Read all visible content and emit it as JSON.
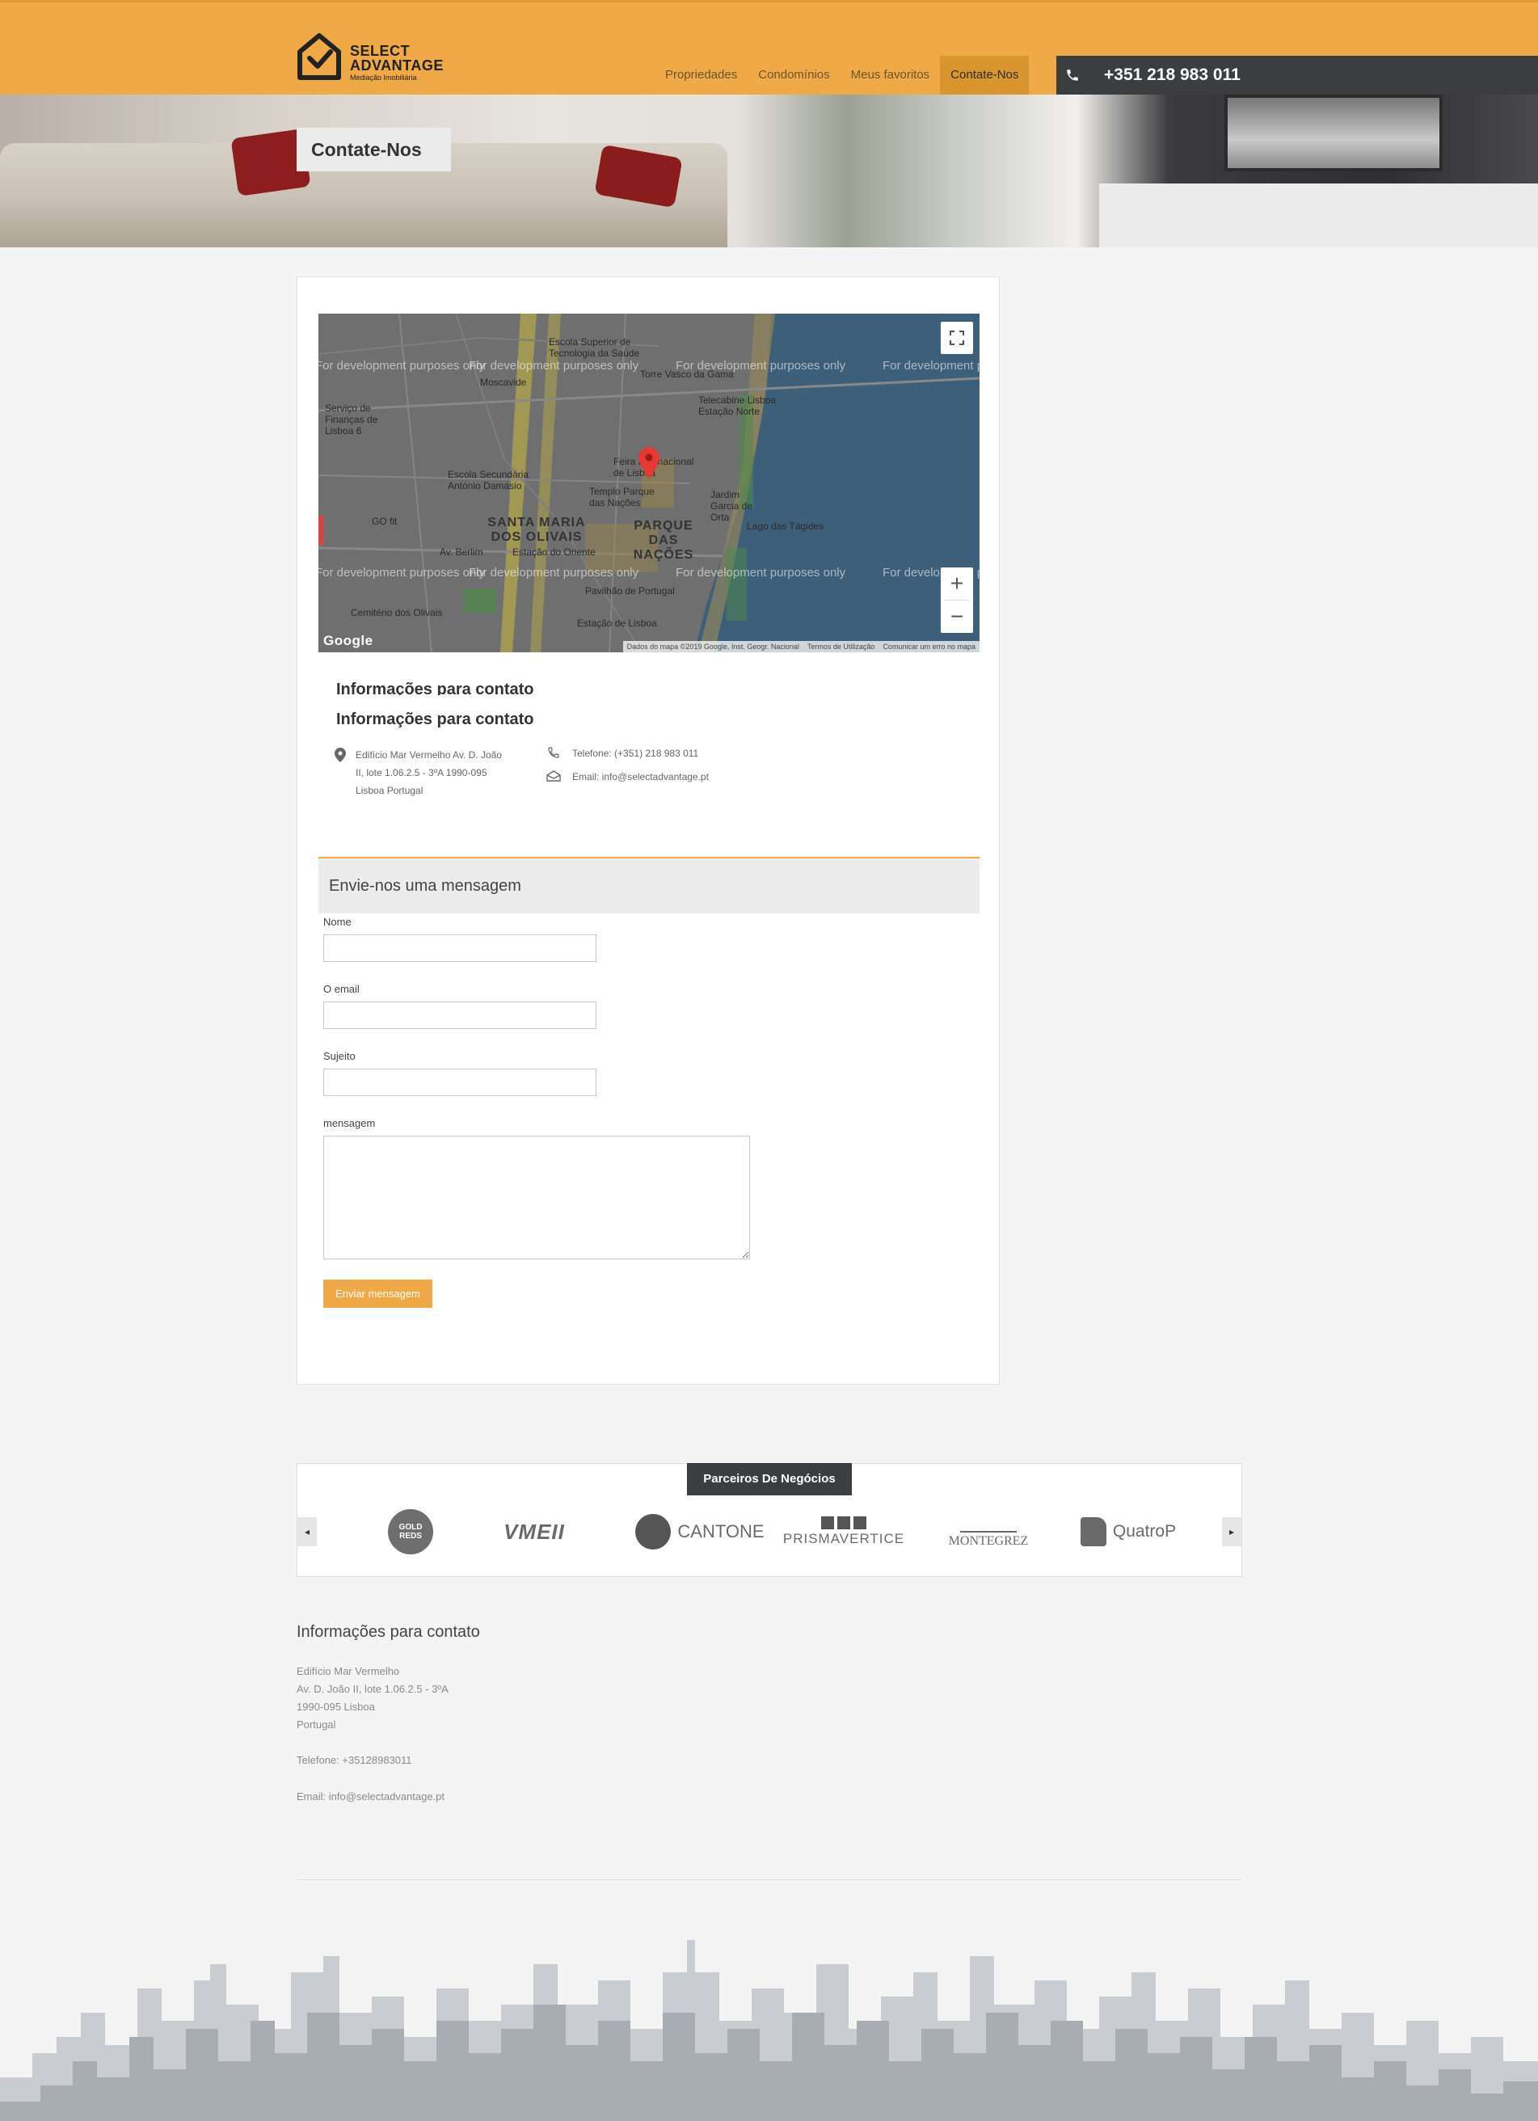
{
  "brand": {
    "line1": "SELECT",
    "line2": "ADVANTAGE",
    "tagline": "Mediação Imobiliária"
  },
  "nav": {
    "items": [
      {
        "label": "Propriedades"
      },
      {
        "label": "Condomínios"
      },
      {
        "label": "Meus favoritos"
      },
      {
        "label": "Contate-Nos"
      }
    ],
    "active": "Contate-Nos",
    "phone": "+351 218 983 011",
    "phone_icon": "phone-icon"
  },
  "hero": {
    "title": "Contate-Nos"
  },
  "map": {
    "watermark": "For development purposes only",
    "labels": [
      "Escola Superior de Tecnologia da Saúde",
      "Moscavide",
      "Torre Vasco da Gama",
      "Telecabine Lisboa Estação Norte",
      "Serviço de Finanças de Lisboa 6",
      "Feira Internacional de Lisboa",
      "Escola Secundária António Damásio",
      "Jardim Garcia de Orta",
      "Templo Parque das Nações",
      "SANTA MARIA DOS OLIVAIS",
      "PARQUE DAS NAÇÕES",
      "Lago das Tágides",
      "GO fit",
      "Estação do Oriente",
      "Pavilhão de Portugal",
      "Cemitério dos Olivais",
      "Estação de Lisboa",
      "Av. Berlim"
    ],
    "attribution": [
      "Dados do mapa ©2019 Google, Inst. Geogr. Nacional",
      "Termos de Utilização",
      "Comunicar um erro no mapa"
    ],
    "google": "Google",
    "fullscreen_icon": "fullscreen-icon",
    "zoom_in": "+",
    "zoom_out": "−",
    "water_color": "#3e5f7a",
    "land_color": "#6f6f70"
  },
  "contact": {
    "heading": "Informações para contato",
    "address": [
      "Edifício Mar Vermelho Av. D. João",
      "II, lote 1.06.2.5 - 3ºA 1990-095",
      "Lisboa Portugal"
    ],
    "phone": "Telefone: (+351) 218 983 011",
    "email": "Email: info@selectadvantage.pt"
  },
  "form": {
    "title": "Envie-nos uma mensagem",
    "name_label": "Nome",
    "email_label": "O email",
    "subject_label": "Sujeito",
    "message_label": "mensagem",
    "name_value": "",
    "email_value": "",
    "subject_value": "",
    "message_value": "",
    "submit": "Enviar mensagem"
  },
  "partners": {
    "title": "Parceiros De Negócios",
    "logos": [
      {
        "name": "GOLD REDS",
        "line1": "GOLD",
        "line2": "REDS"
      },
      {
        "name": "VME II",
        "text": "VMEII"
      },
      {
        "name": "CANTONE",
        "text": "CANTONE"
      },
      {
        "name": "PRISMAVERTICE",
        "text": "PRISMAVERTICE"
      },
      {
        "name": "MONTEGREZ",
        "text": "MONTEGREZ"
      },
      {
        "name": "Quatro P",
        "text": "QuatroP"
      }
    ],
    "prev_icon": "chevron-left-icon",
    "next_icon": "chevron-right-icon"
  },
  "footer": {
    "heading": "Informações para contato",
    "address": [
      "Edifício Mar Vermelho",
      "Av. D. João II, lote 1.06.2.5 - 3ºA",
      "1990-095 Lisboa",
      "Portugal"
    ],
    "phone": "Telefone: +35128983011",
    "email": "Email: info@selectadvantage.pt"
  },
  "colors": {
    "accent": "#efaa47",
    "dark": "#3a3e41",
    "background": "#f4f4f4"
  }
}
